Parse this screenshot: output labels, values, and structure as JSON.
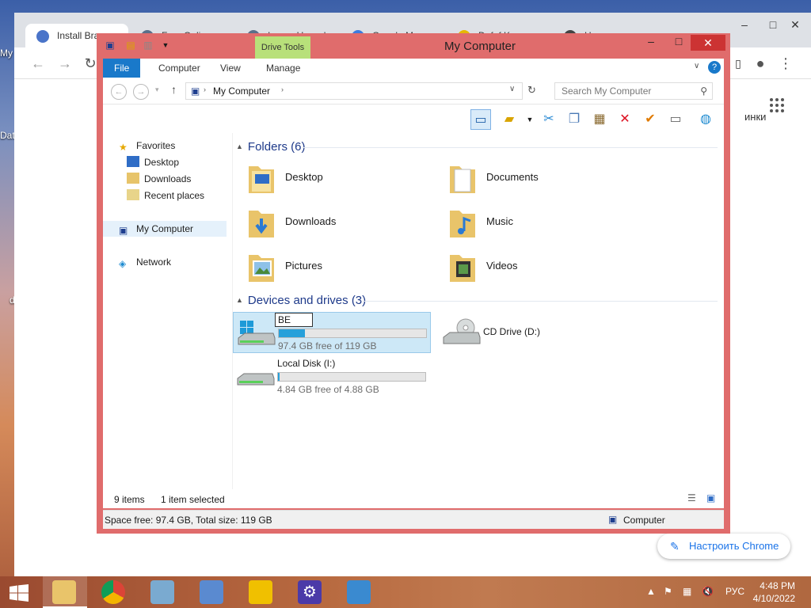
{
  "desktop": {
    "labels": [
      "My",
      "Dat",
      "d"
    ]
  },
  "chrome": {
    "tabs": [
      {
        "label": "Install Bra"
      },
      {
        "label": "Free Online"
      },
      {
        "label": "Image Upscal"
      },
      {
        "label": "Google Maps"
      },
      {
        "label": "Dafaf Keepo"
      },
      {
        "label": "Новая вкладка"
      }
    ],
    "side_text": "инки",
    "customize_label": "Настроить Chrome"
  },
  "explorer": {
    "title": "My Computer",
    "drive_tools_label": "Drive Tools",
    "ribbon_tabs": [
      "File",
      "Computer",
      "View",
      "Manage"
    ],
    "address": "My Computer",
    "search_placeholder": "Search My Computer",
    "nav": {
      "favorites": "Favorites",
      "desktop": "Desktop",
      "downloads": "Downloads",
      "recent": "Recent places",
      "mycomputer": "My Computer",
      "network": "Network"
    },
    "folders_header": "Folders (6)",
    "folders": [
      "Desktop",
      "Documents",
      "Downloads",
      "Music",
      "Pictures",
      "Videos"
    ],
    "drives_header": "Devices and drives (3)",
    "drives": [
      {
        "rename_value": "BE",
        "free_text": "97.4 GB free of 119 GB",
        "used_fraction": 0.18,
        "selected": true
      },
      {
        "name": "CD Drive (D:)"
      },
      {
        "name": "Local Disk (I:)",
        "free_text": "4.84 GB free of 4.88 GB",
        "used_fraction": 0.01
      }
    ],
    "status": {
      "items": "9 items",
      "selected": "1 item selected"
    },
    "details": {
      "space": "Space free: 97.4 GB, Total size: 119 GB",
      "location": "Computer"
    }
  },
  "taskbar": {
    "lang": "РУС",
    "time": "4:48 PM",
    "date": "4/10/2022"
  },
  "colors": {
    "window_frame": "#e06c6c",
    "file_tab": "#1979ca",
    "drive_tools": "#b8e07a",
    "selection": "#cde8f7",
    "header_text": "#1e3a8a"
  }
}
